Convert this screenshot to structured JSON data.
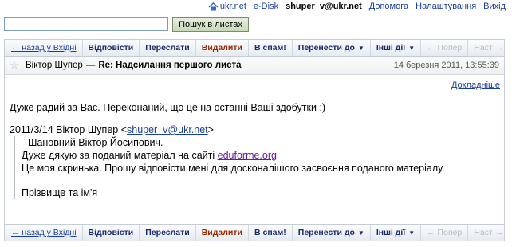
{
  "top_links": {
    "ukr_net": "ukr.net",
    "edisk": "e-Disk",
    "user": "shuper_v@ukr.net",
    "help": "Допомога",
    "settings": "Налаштування",
    "logout": "Вихід"
  },
  "search": {
    "value": "",
    "button_label": "Пошук в листах"
  },
  "toolbar": {
    "back": "← назад у Вхідні",
    "reply": "Відповісти",
    "forward": "Переслати",
    "delete": "Видалити",
    "spam": "В спам!",
    "move": "Перенести до",
    "other": "Інші дії",
    "prev": "← Попер",
    "next": "Наст →"
  },
  "message": {
    "sender": "Віктор Шупер",
    "dash": "—",
    "subject": "Re: Надсилання першого листа",
    "date": "14 березня 2011, 13:55:39",
    "details": "Докладніше",
    "body_line": "Дуже радий за Вас. Переконаний, що це на останні Ваші здобутки :)",
    "quote_head_prefix": "2011/3/14 Віктор Шупер <",
    "quote_head_email": "shuper_v@ukr.net",
    "quote_head_suffix": ">",
    "quote_greeting": "Шановний Віктор Йосипович.",
    "quote_line2_prefix": "Дуже дякую за поданий матеріал на сайті ",
    "quote_line2_link": "eduforme.org",
    "quote_line3": "Це моя скринька. Прошу відповісти мені для досконалішого засвоєння поданого матеріалу.",
    "quote_signature": "Прізвище та ім'я"
  },
  "colors": {
    "link": "#1a3e9c",
    "delete": "#9b2a00",
    "disabled": "#b8bcc2"
  },
  "icons": {
    "home": "home-icon",
    "star": "star-icon",
    "caret": "caret-down-icon"
  }
}
